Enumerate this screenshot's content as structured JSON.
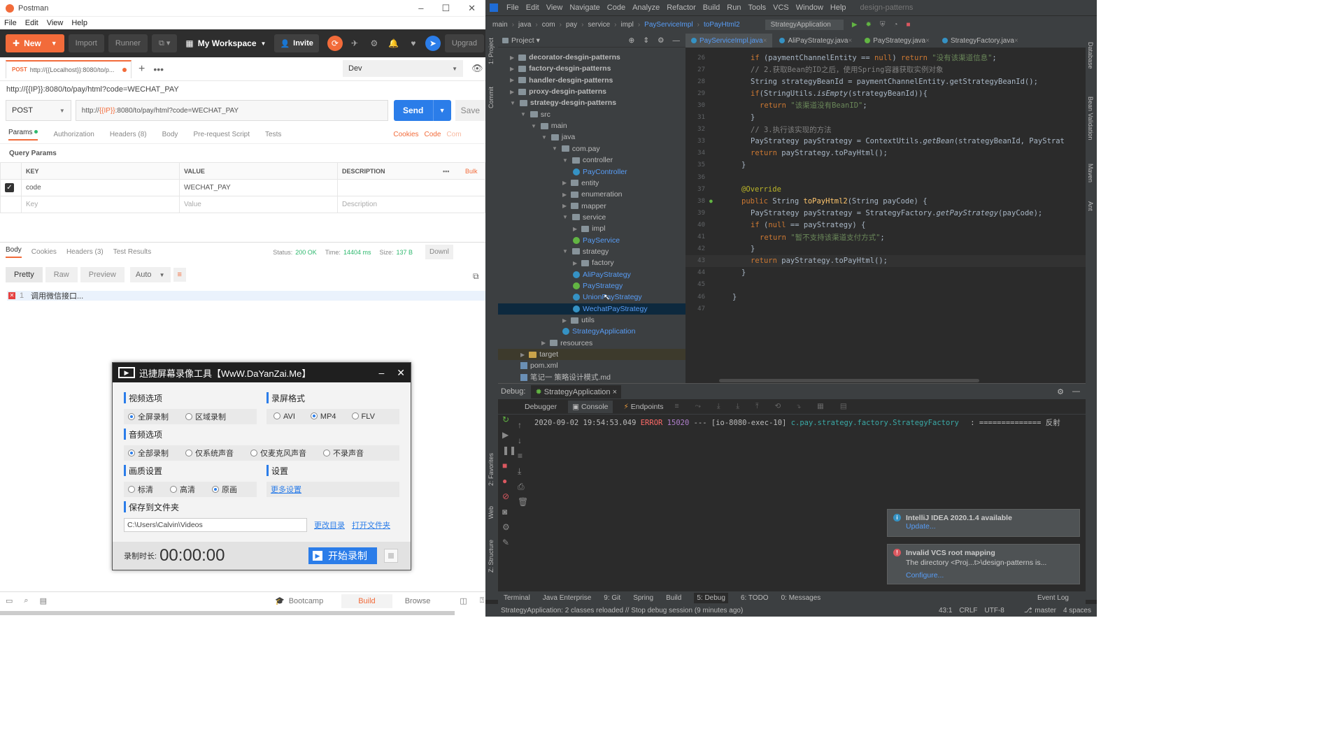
{
  "postman": {
    "title": "Postman",
    "menu": [
      "File",
      "Edit",
      "View",
      "Help"
    ],
    "toolbar": {
      "new": "New",
      "import": "Import",
      "runner": "Runner",
      "workspace": "My Workspace",
      "invite": "Invite",
      "upgrade": "Upgrad"
    },
    "tab": {
      "method": "POST",
      "url": "http://{{Localhost}}:8080/to/p..."
    },
    "env": "Dev",
    "breadcrumb": "http://{{IP}}:8080/to/pay/html?code=WECHAT_PAY",
    "request": {
      "method": "POST",
      "url_prefix": "http://",
      "url_var": "{{IP}}",
      "url_rest": ":8080/to/pay/html?code=WECHAT_PAY",
      "send": "Send",
      "save": "Save"
    },
    "subtabs": [
      "Params",
      "Authorization",
      "Headers (8)",
      "Body",
      "Pre-request Script",
      "Tests"
    ],
    "subtabs_right": [
      "Cookies",
      "Code",
      "Com"
    ],
    "query_title": "Query Params",
    "table": {
      "key": "KEY",
      "value": "VALUE",
      "description": "DESCRIPTION",
      "bulk": "Bulk",
      "row_key": "code",
      "row_value": "WECHAT_PAY",
      "ph_key": "Key",
      "ph_value": "Value",
      "ph_desc": "Description"
    },
    "resp_tabs": [
      "Body",
      "Cookies",
      "Headers (3)",
      "Test Results"
    ],
    "status": {
      "label": "Status:",
      "value": "200 OK",
      "time_label": "Time:",
      "time": "14404 ms",
      "size_label": "Size:",
      "size": "137 B",
      "download": "Downl"
    },
    "view": {
      "pretty": "Pretty",
      "raw": "Raw",
      "preview": "Preview",
      "auto": "Auto"
    },
    "response_line": "调用微信接口...",
    "bottom": {
      "bootcamp": "Bootcamp",
      "build": "Build",
      "browse": "Browse"
    }
  },
  "recorder": {
    "title": "迅捷屏幕录像工具【WwW.DaYanZai.Me】",
    "video": "视频选项",
    "video_opts": [
      "全屏录制",
      "区域录制"
    ],
    "format": "录屏格式",
    "format_opts": [
      "AVI",
      "MP4",
      "FLV"
    ],
    "audio": "音频选项",
    "audio_opts": [
      "全部录制",
      "仅系统声音",
      "仅麦克风声音",
      "不录声音"
    ],
    "quality": "画质设置",
    "quality_opts": [
      "标清",
      "高清",
      "原画"
    ],
    "settings": "设置",
    "more": "更多设置",
    "folder": "保存到文件夹",
    "path": "C:\\Users\\Calvin\\Videos",
    "change": "更改目录",
    "open": "打开文件夹",
    "duration_label": "录制时长:",
    "duration": "00:00:00",
    "start": "开始录制"
  },
  "idea": {
    "menu": [
      "File",
      "Edit",
      "View",
      "Navigate",
      "Code",
      "Analyze",
      "Refactor",
      "Build",
      "Run",
      "Tools",
      "VCS",
      "Window",
      "Help",
      "design-patterns"
    ],
    "nav": [
      "main",
      "java",
      "com",
      "pay",
      "service",
      "impl",
      "PayServiceImpl",
      "toPayHtml2"
    ],
    "run_config": "StrategyApplication",
    "project_label": "Project",
    "tabs": [
      "PayServiceImpl.java",
      "AliPayStrategy.java",
      "PayStrategy.java",
      "StrategyFactory.java"
    ],
    "tree": [
      {
        "t": "decorator-desgin-patterns",
        "d": 1,
        "k": "f"
      },
      {
        "t": "factory-desgin-patterns",
        "d": 1,
        "k": "f"
      },
      {
        "t": "handler-desgin-patterns",
        "d": 1,
        "k": "f"
      },
      {
        "t": "proxy-desgin-patterns",
        "d": 1,
        "k": "f"
      },
      {
        "t": "strategy-desgin-patterns",
        "d": 1,
        "k": "f"
      },
      {
        "t": "src",
        "d": 2,
        "k": "f"
      },
      {
        "t": "main",
        "d": 3,
        "k": "f"
      },
      {
        "t": "java",
        "d": 4,
        "k": "f"
      },
      {
        "t": "com.pay",
        "d": 5,
        "k": "f"
      },
      {
        "t": "controller",
        "d": 6,
        "k": "f"
      },
      {
        "t": "PayController",
        "d": 7,
        "k": "c"
      },
      {
        "t": "entity",
        "d": 6,
        "k": "f"
      },
      {
        "t": "enumeration",
        "d": 6,
        "k": "f"
      },
      {
        "t": "mapper",
        "d": 6,
        "k": "f"
      },
      {
        "t": "service",
        "d": 6,
        "k": "f"
      },
      {
        "t": "impl",
        "d": 7,
        "k": "f"
      },
      {
        "t": "PayService",
        "d": 7,
        "k": "i"
      },
      {
        "t": "strategy",
        "d": 6,
        "k": "f"
      },
      {
        "t": "factory",
        "d": 7,
        "k": "f"
      },
      {
        "t": "AliPayStrategy",
        "d": 7,
        "k": "c"
      },
      {
        "t": "PayStrategy",
        "d": 7,
        "k": "i"
      },
      {
        "t": "UnionPayStrategy",
        "d": 7,
        "k": "c"
      },
      {
        "t": "WechatPayStrategy",
        "d": 7,
        "k": "c"
      },
      {
        "t": "utils",
        "d": 6,
        "k": "f"
      },
      {
        "t": "StrategyApplication",
        "d": 6,
        "k": "c"
      },
      {
        "t": "resources",
        "d": 4,
        "k": "f"
      },
      {
        "t": "target",
        "d": 2,
        "k": "f"
      },
      {
        "t": "pom.xml",
        "d": 2,
        "k": "m"
      },
      {
        "t": "笔记一 策略设计模式.md",
        "d": 2,
        "k": "m"
      }
    ],
    "code": [
      {
        "n": "26",
        "h": "<span class='kw'>if</span> (paymentChannelEntity == <span class='kw'>null</span>) <span class='kw'>return</span> <span class='str'>\"没有该渠道信息\"</span>;",
        "i": 3
      },
      {
        "n": "27",
        "h": "<span class='cm'>// 2.获取Bean的ID之后，使用Spring容器获取实例对象</span>",
        "i": 3
      },
      {
        "n": "28",
        "h": "String strategyBeanId = paymentChannelEntity.getStrategyBeanId();",
        "i": 3
      },
      {
        "n": "29",
        "h": "<span class='kw'>if</span>(StringUtils.<span class='it'>isEmpty</span>(strategyBeanId)){",
        "i": 3
      },
      {
        "n": "30",
        "h": "<span class='kw'>return</span> <span class='str'>\"该渠道没有BeanID\"</span>;",
        "i": 4
      },
      {
        "n": "31",
        "h": "}",
        "i": 3
      },
      {
        "n": "32",
        "h": "<span class='cm'>// 3.执行该实现的方法</span>",
        "i": 3
      },
      {
        "n": "33",
        "h": "PayStrategy payStrategy = ContextUtils.<span class='it'>getBean</span>(strategyBeanId, PayStrat",
        "i": 3
      },
      {
        "n": "34",
        "h": "<span class='kw'>return</span> payStrategy.toPayHtml();",
        "i": 3
      },
      {
        "n": "35",
        "h": "}",
        "i": 2
      },
      {
        "n": "36",
        "h": "",
        "i": 0
      },
      {
        "n": "37",
        "h": "<span class='an'>@Override</span>",
        "i": 2
      },
      {
        "n": "38",
        "h": "<span class='kw'>public</span> String <span class='fn'>toPayHtml2</span>(String payCode) {",
        "i": 2
      },
      {
        "n": "39",
        "h": "PayStrategy payStrategy = StrategyFactory.<span class='it'>getPayStrategy</span>(payCode);",
        "i": 3
      },
      {
        "n": "40",
        "h": "<span class='kw'>if</span> (<span class='kw'>null</span> == payStrategy) {",
        "i": 3
      },
      {
        "n": "41",
        "h": "<span class='kw'>return</span> <span class='str'>\"暂不支持该渠道支付方式\"</span>;",
        "i": 4
      },
      {
        "n": "42",
        "h": "}",
        "i": 3
      },
      {
        "n": "43",
        "h": "<span class='kw'>return</span> payStrategy.toPayHtml();",
        "i": 3
      },
      {
        "n": "44",
        "h": "}",
        "i": 2
      },
      {
        "n": "45",
        "h": "",
        "i": 0
      },
      {
        "n": "46",
        "h": "}",
        "i": 1
      },
      {
        "n": "47",
        "h": "",
        "i": 0
      }
    ],
    "debug": {
      "label": "Debug:",
      "config": "StrategyApplication",
      "tabs": [
        "Debugger",
        "Console",
        "Endpoints"
      ],
      "log_time": "2020-09-02 19:54:53.049",
      "log_level": "ERROR",
      "log_pid": "15020",
      "log_thread": "--- [io-8080-exec-10]",
      "log_class": "c.pay.strategy.factory.StrategyFactory",
      "log_msg": ": ============== 反射"
    },
    "notifications": [
      {
        "title": "IntelliJ IDEA 2020.1.4 available",
        "link": "Update..."
      },
      {
        "title": "Invalid VCS root mapping",
        "body": "The directory <Proj...t>\\design-patterns is...",
        "link": "Configure..."
      }
    ],
    "toolwindows": [
      "Terminal",
      "Java Enterprise",
      "9: Git",
      "Spring",
      "Build",
      "5: Debug",
      "6: TODO",
      "0: Messages",
      "Event Log"
    ],
    "status": {
      "msg": "StrategyApplication: 2 classes reloaded // Stop debug session (9 minutes ago)",
      "pos": "43:1",
      "crlf": "CRLF",
      "enc": "UTF-8",
      "branch": "master",
      "indent": "4 spaces"
    }
  }
}
